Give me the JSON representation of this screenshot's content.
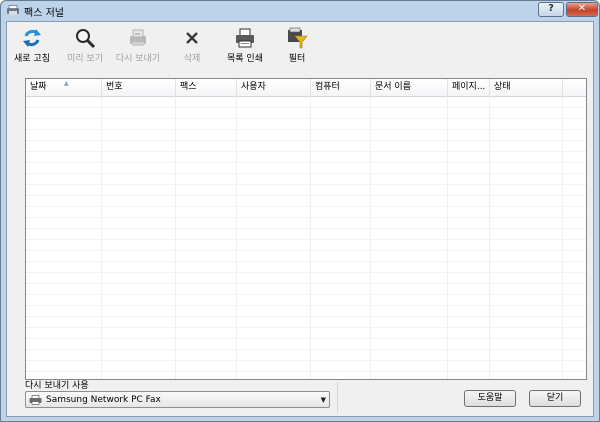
{
  "window": {
    "title": "팩스 저널",
    "help_button": "?",
    "close_button": "✕"
  },
  "toolbar": {
    "items": [
      {
        "label": "새로 고침",
        "icon": "refresh-icon",
        "enabled": true
      },
      {
        "label": "미리 보기",
        "icon": "magnifier-icon",
        "enabled": false
      },
      {
        "label": "다시 보내기",
        "icon": "resend-fax-icon",
        "enabled": false
      },
      {
        "label": "삭제",
        "icon": "delete-x-icon",
        "enabled": false
      },
      {
        "label": "목록 인쇄",
        "icon": "printer-icon",
        "enabled": true
      },
      {
        "label": "필터",
        "icon": "filter-funnel-icon",
        "enabled": true
      }
    ]
  },
  "table": {
    "columns": [
      "날짜",
      "번호",
      "팩스",
      "사용자",
      "컴퓨터",
      "문서 이름",
      "페이지...",
      "상태"
    ],
    "rows": []
  },
  "resend": {
    "label": "다시 보내기 사용",
    "selected": "Samsung Network PC Fax"
  },
  "buttons": {
    "help": "도움말",
    "close": "닫기"
  },
  "colors": {
    "frame": "#bcd3ea",
    "close_button": "#c5422a",
    "refresh_icon": "#2a8fd8",
    "filter_icon": "#e8b820"
  }
}
